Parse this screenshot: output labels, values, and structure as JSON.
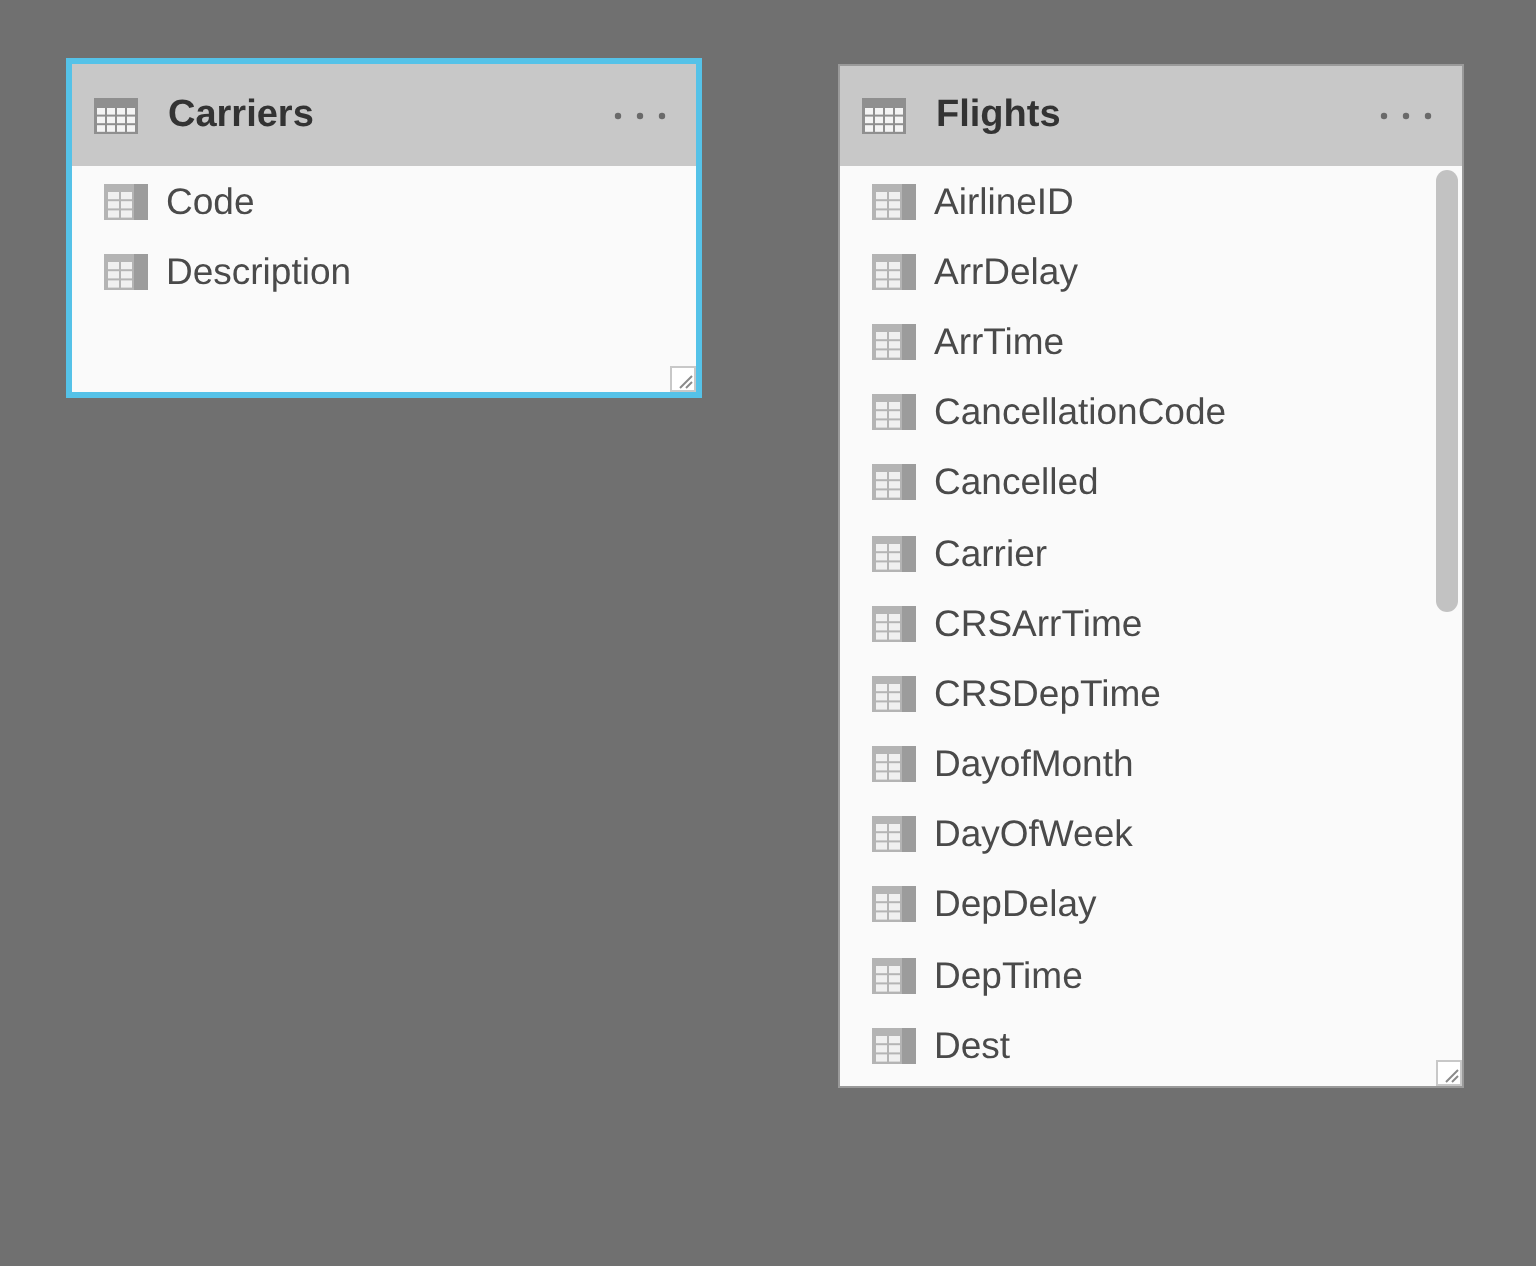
{
  "tables": [
    {
      "title": "Carriers",
      "selected": true,
      "scrollable": false,
      "fields": [
        "Code",
        "Description"
      ]
    },
    {
      "title": "Flights",
      "selected": false,
      "scrollable": true,
      "fields": [
        "AirlineID",
        "ArrDelay",
        "ArrTime",
        "CancellationCode",
        "Cancelled",
        "Carrier",
        "CRSArrTime",
        "CRSDepTime",
        "DayofMonth",
        "DayOfWeek",
        "DepDelay",
        "DepTime",
        "Dest"
      ]
    }
  ]
}
